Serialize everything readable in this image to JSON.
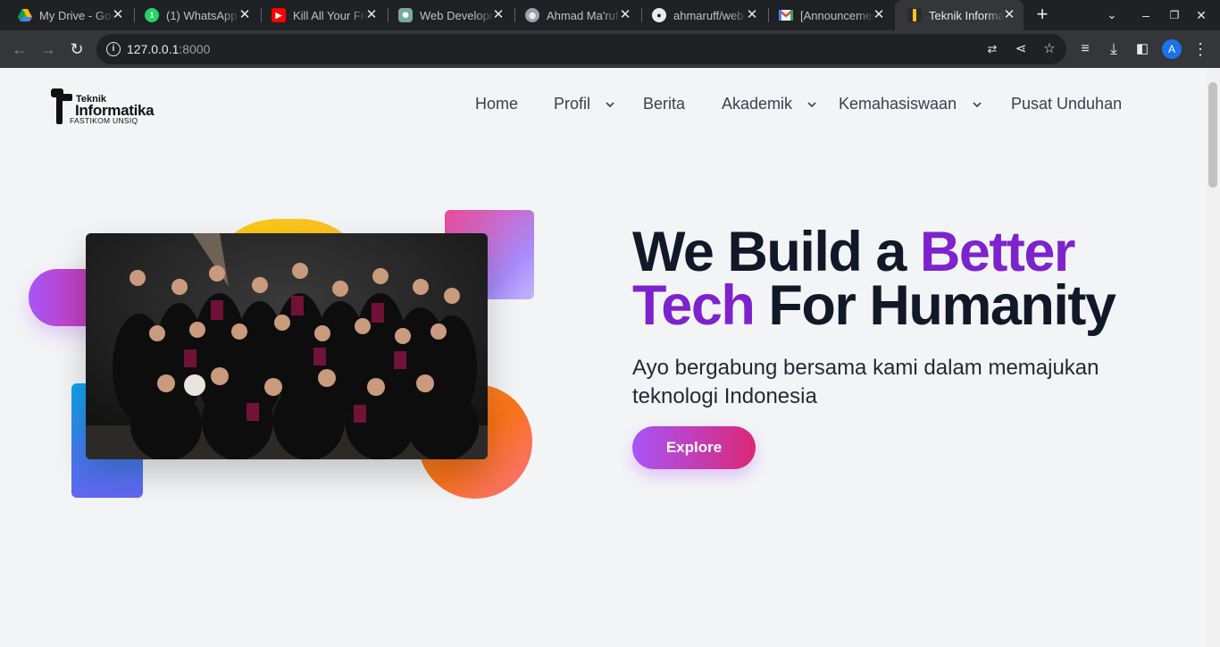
{
  "browser": {
    "tabs": [
      {
        "title": "My Drive - Google Drive",
        "icon": "google-drive-icon"
      },
      {
        "title": "(1) WhatsApp",
        "icon": "whatsapp-icon"
      },
      {
        "title": "Kill All Your Friends",
        "icon": "youtube-icon"
      },
      {
        "title": "Web Development",
        "icon": "chatgpt-icon"
      },
      {
        "title": "Ahmad Ma'ruf",
        "icon": "globe-icon"
      },
      {
        "title": "ahmaruff/web",
        "icon": "github-icon"
      },
      {
        "title": "[Announcement]",
        "icon": "gmail-icon"
      },
      {
        "title": "Teknik Informatika",
        "icon": "site-favicon",
        "active": true
      }
    ],
    "address": {
      "host": "127.0.0.1",
      "port": ":8000"
    },
    "profile_initial": "A"
  },
  "site": {
    "logo": {
      "line1": "Teknik",
      "line2": "Informatika",
      "line3": "FASTIKOM UNSIQ"
    },
    "nav": {
      "home": "Home",
      "profil": "Profil",
      "berita": "Berita",
      "akademik": "Akademik",
      "kemahasiswaan": "Kemahasiswaan",
      "pusat_unduhan": "Pusat Unduhan"
    },
    "hero": {
      "title_part1": "We Build a ",
      "title_accent1": "Better",
      "title_accent2": "Tech",
      "title_part2": " For Humanity",
      "subtitle": "Ayo bergabung bersama kami dalam memajukan teknologi Indonesia",
      "cta": "Explore"
    }
  },
  "colors": {
    "accent_purple": "#7e22ce",
    "heading_dark": "#111827",
    "cta_gradient_start": "#a855f7",
    "cta_gradient_end": "#db2777"
  }
}
